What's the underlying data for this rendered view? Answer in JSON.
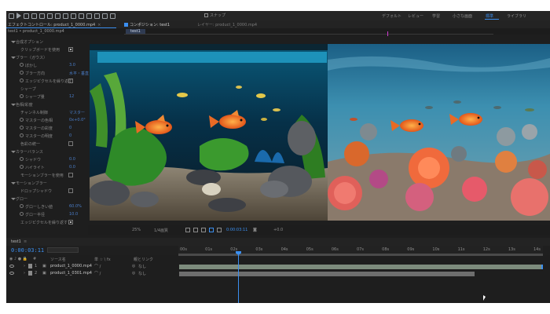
{
  "toolbar": {
    "snap_label": "スナップ",
    "workspaces": [
      {
        "label": "デフォルト",
        "active": false
      },
      {
        "label": "レビュー",
        "active": false
      },
      {
        "label": "学習",
        "active": false
      },
      {
        "label": "小さな画面",
        "active": false
      },
      {
        "label": "標準",
        "active": true
      },
      {
        "label": "ライブラリ",
        "active": false
      }
    ]
  },
  "tabs": {
    "effects": "エフェクトコントロール: product_1_0000.mp4",
    "composition": "コンポジション: test1",
    "layer": "レイヤー: product_1_0000.mp4",
    "sub_left": "test1 • product_1_0000.mp4",
    "sub_comp": "test1"
  },
  "effects": {
    "rows": [
      {
        "label": "合成オプション",
        "indent": 1
      },
      {
        "label": "クリップボードを使用",
        "indent": 2,
        "check": true
      },
      {
        "label": "ブラー（ガウス）",
        "indent": 1
      },
      {
        "label": "ぼかし",
        "indent": 3,
        "value": "3.0"
      },
      {
        "label": "ブラー方向",
        "indent": 3,
        "value": "水平・垂直"
      },
      {
        "label": "エッジピクセルを繰り返す",
        "indent": 3,
        "check": false
      },
      {
        "label": "シャープ",
        "indent": 2
      },
      {
        "label": "シャープ量",
        "indent": 3,
        "value": "12"
      },
      {
        "label": "色相/彩度",
        "indent": 1
      },
      {
        "label": "チャンネル制御",
        "indent": 2,
        "value": "マスター"
      },
      {
        "label": "マスターの色相",
        "indent": 3,
        "value": "0x+0.0°"
      },
      {
        "label": "マスターの彩度",
        "indent": 3,
        "value": "0"
      },
      {
        "label": "マスターの明度",
        "indent": 3,
        "value": "0"
      },
      {
        "label": "色彩の統一",
        "indent": 2,
        "check": false
      },
      {
        "label": "カラーバランス",
        "indent": 1
      },
      {
        "label": "シャドウ",
        "indent": 3,
        "value": "0.0"
      },
      {
        "label": "ハイライト",
        "indent": 3,
        "value": "0.0"
      },
      {
        "label": "モーションブラーを使用",
        "indent": 2,
        "check": false
      },
      {
        "label": "モーションブラー",
        "indent": 1
      },
      {
        "label": "ドロップシャドウ",
        "indent": 2,
        "check": false
      },
      {
        "label": "グロー",
        "indent": 1
      },
      {
        "label": "グローしきい値",
        "indent": 3,
        "value": "60.0%"
      },
      {
        "label": "グロー半径",
        "indent": 3,
        "value": "10.0"
      },
      {
        "label": "エッジピクセルを繰り返す",
        "indent": 2,
        "check": true
      }
    ]
  },
  "viewer_footer": {
    "zoom": "25%",
    "resolution": "1/4画質",
    "time": "0:00:03:11",
    "camera": "アクティブカメラ",
    "views": "1画面",
    "exposure": "+0.0"
  },
  "timeline": {
    "comp_name": "test1",
    "timecode": "0:00:03:11",
    "ruler_ticks": [
      "00s",
      "01s",
      "02s",
      "03s",
      "04s",
      "05s",
      "06s",
      "07s",
      "08s",
      "09s",
      "10s",
      "11s",
      "12s",
      "13s",
      "14s"
    ],
    "column_headers": {
      "num": "#",
      "source": "ソース名",
      "switches": "単 ☆ \\ fx",
      "parent": "親とリンク"
    },
    "layers": [
      {
        "num": "1",
        "name": "product_1_0000.mp4",
        "parent": "なし"
      },
      {
        "num": "2",
        "name": "product_1_0301.mp4",
        "parent": "なし"
      }
    ]
  },
  "colors": {
    "accent": "#3b8ff0",
    "panel": "#1e1e1e",
    "marker": "#d13bd0"
  }
}
